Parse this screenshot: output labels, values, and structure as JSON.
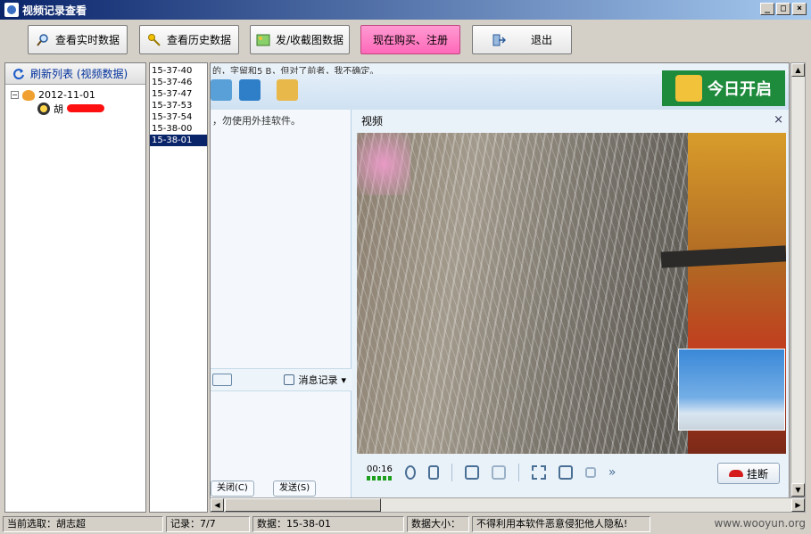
{
  "window": {
    "title": "视频记录查看",
    "buttons": [
      "_",
      "□",
      "×"
    ]
  },
  "toolbar": {
    "realtime": "查看实时数据",
    "history": "查看历史数据",
    "screenshots": "发/收截图数据",
    "buy": "现在购买、注册",
    "exit": "退出",
    "buy_color": "#ff69b9"
  },
  "sidebar": {
    "refresh_label": "刷新列表 (视频数据)",
    "tree": {
      "date": "2012-11-01",
      "user": "胡"
    }
  },
  "timelist": {
    "items": [
      "15-37-40",
      "15-37-46",
      "15-37-47",
      "15-37-53",
      "15-37-54",
      "15-38-00",
      "15-38-01"
    ],
    "selected_index": 6
  },
  "viewer": {
    "topstrip": "的，字留和5 B，但对了前者，我不确定。",
    "chat_notice": "，勿使用外挂软件。",
    "msg_record": "消息记录",
    "bottom_buttons": [
      "关闭(C)",
      "发送(S)"
    ],
    "banner_text": "今日开启",
    "video_title": "视频",
    "video_close": "×",
    "timer": "00:16",
    "hangup": "挂断",
    "more": "»"
  },
  "statusbar": {
    "current": "当前选取：胡志超",
    "record": "记录：7/7",
    "data": "数据：15-38-01",
    "size": "数据大小：",
    "notice": "不得利用本软件恶意侵犯他人隐私!"
  },
  "watermark": "www.wooyun.org"
}
